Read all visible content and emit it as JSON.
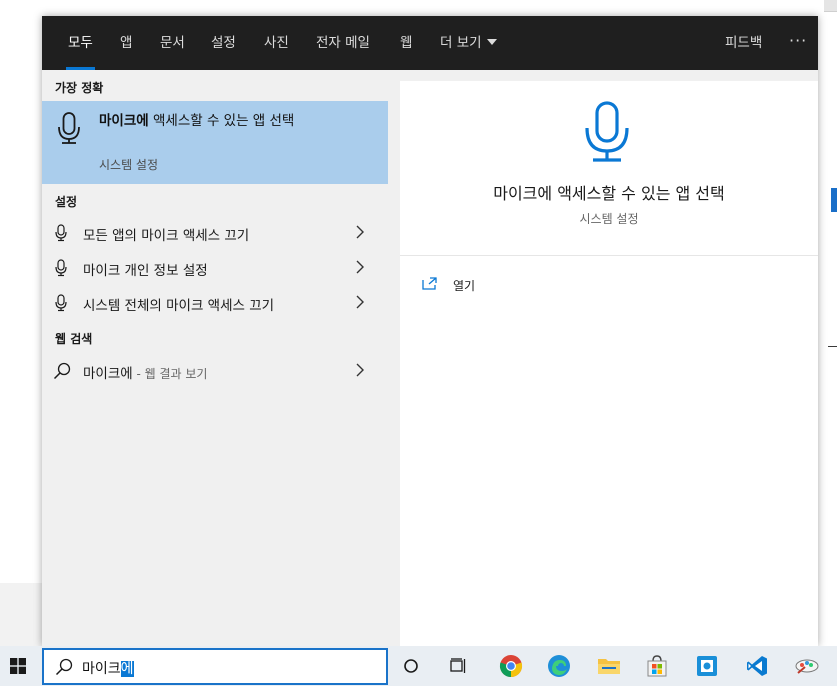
{
  "tabs": [
    {
      "label": "모두",
      "active": true
    },
    {
      "label": "앱"
    },
    {
      "label": "문서"
    },
    {
      "label": "설정"
    },
    {
      "label": "사진"
    },
    {
      "label": "전자 메일"
    },
    {
      "label": "웹"
    },
    {
      "label": "더 보기"
    }
  ],
  "feedback_label": "피드백",
  "more_label": "···",
  "best_match": {
    "heading": "가장 정확",
    "title_bold": "마이크에",
    "title_rest": " 액세스할 수 있는 앱 선택",
    "subtitle": "시스템 설정",
    "icon": "microphone-icon"
  },
  "settings": {
    "heading": "설정",
    "items": [
      {
        "label": "모든 앱의 마이크 액세스 끄기",
        "icon": "microphone-icon"
      },
      {
        "label": "마이크 개인 정보 설정",
        "icon": "microphone-icon"
      },
      {
        "label": "시스템 전체의 마이크 액세스 끄기",
        "icon": "microphone-icon"
      }
    ]
  },
  "web": {
    "heading": "웹 검색",
    "item_query": "마이크에",
    "item_suffix": " - 웹 결과 보기",
    "icon": "search-icon"
  },
  "preview": {
    "title": "마이크에 액세스할 수 있는 앱 선택",
    "subtitle": "시스템 설정",
    "open_label": "열기",
    "icon": "microphone-icon"
  },
  "search": {
    "query_plain": "마이크",
    "query_selected": "에",
    "icon": "search-icon"
  },
  "taskbar": {
    "icons": [
      "windows-start-icon",
      "cortana-icon",
      "task-view-icon",
      "chrome-icon",
      "edge-icon",
      "file-explorer-icon",
      "store-icon",
      "app-icon",
      "vscode-icon",
      "paint-icon"
    ]
  },
  "colors": {
    "accent": "#0a78d4",
    "selected_row": "#aacdec",
    "topbar": "#1f1f1f"
  }
}
